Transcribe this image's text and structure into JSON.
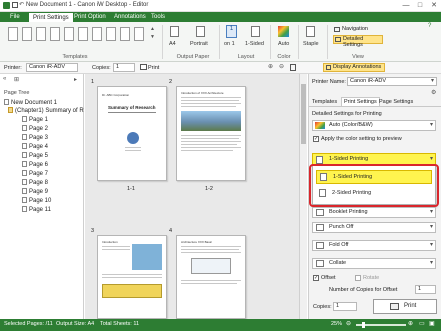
{
  "window": {
    "title": "New Document 1 - Canon iW Desktop - Editor",
    "minimize": "—",
    "maximize": "□",
    "close": "✕"
  },
  "ribbon_tabs": [
    "File",
    "Print Settings",
    "Print Option",
    "Annotations",
    "Tools"
  ],
  "ribbon": {
    "groups": [
      "Templates",
      "Output Paper",
      "Layout",
      "Color",
      "View"
    ],
    "paper_size": "A4",
    "orientation": "Portrait",
    "pages_per_sheet_num": "1",
    "pages_per_sheet": "on 1",
    "sides": "1-Sided",
    "color_mode": "Auto",
    "staple": "Staple",
    "navigation": "Navigation",
    "detailed_settings": "Detailed Settings"
  },
  "toolbar": {
    "printer_label": "Printer:",
    "printer_value": "Canon iR-ADV",
    "copies_label": "Copies:",
    "copies_value": "1",
    "print_label": "Print",
    "display_annotations": "Display Annotations"
  },
  "tree": {
    "header": "Page Tree",
    "document": "New Document 1",
    "chapter": "(Chapter1) Summary of R",
    "pages": [
      "Page 1",
      "Page 2",
      "Page 3",
      "Page 4",
      "Page 5",
      "Page 6",
      "Page 7",
      "Page 8",
      "Page 9",
      "Page 10",
      "Page 11"
    ]
  },
  "pages": {
    "labels": [
      "1-1",
      "1-2"
    ],
    "numbers": [
      "1",
      "2",
      "3",
      "4"
    ],
    "page1_title": "Summary of Research",
    "page1_header": "Dr. ABC Corporation",
    "page2_title": "Introduction of XXX Architecture",
    "page3_title": "Introduction",
    "page4_title": "Architecture XXX Basic"
  },
  "rightpane": {
    "printer_name_label": "Printer Name:",
    "printer_name_value": "Canon iR-ADV",
    "tabs": [
      "Templates",
      "Print Settings",
      "Page Settings"
    ],
    "detailed_label": "Detailed Settings for Printing",
    "color_value": "Auto (Color/B&W)",
    "apply_color": "Apply the color setting to preview",
    "sided_selected": "1-Sided Printing",
    "sided_options": [
      "1-Sided Printing",
      "2-Sided Printing"
    ],
    "booklet": "Booklet Printing",
    "punch": "Punch Off",
    "fold": "Fold Off",
    "collate": "Collate",
    "offset": "Offset",
    "rotate": "Rotate",
    "offset_copies_label": "Number of Copies for Offset",
    "offset_copies_value": "1",
    "copies_label": "Copies:",
    "copies_value": "1",
    "print_button": "Print"
  },
  "status": {
    "selected": "Selected Pages: /11",
    "output_size": "Output Size: A4",
    "total_sheets": "Total Sheets: 11",
    "zoom": "25%"
  },
  "colors": {
    "brand": "#2d7d33",
    "highlight": "#fff44f",
    "callout": "#d9262c"
  }
}
